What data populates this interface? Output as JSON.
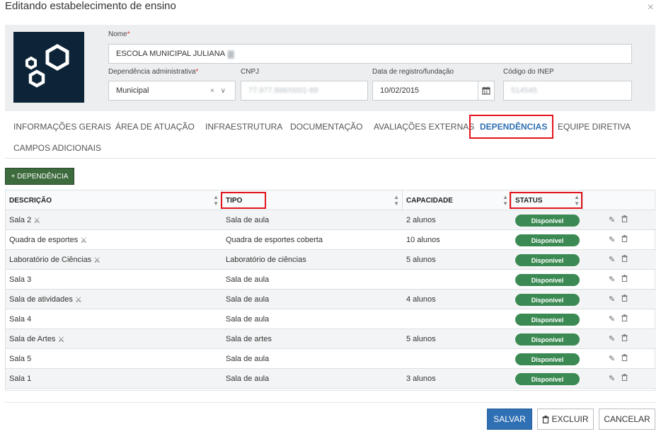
{
  "modal": {
    "title": "Editando estabelecimento de ensino",
    "close_label": "×"
  },
  "form": {
    "nome_label": "Nome",
    "nome_value": "ESCOLA MUNICIPAL JULIANA",
    "dep_admin_label": "Dependência administrativa",
    "dep_admin_value": "Municipal",
    "cnpj_label": "CNPJ",
    "cnpj_value": "77.977.866/0001-89",
    "data_label": "Data de registro/fundação",
    "data_value": "10/02/2015",
    "inep_label": "Código do INEP",
    "inep_value": "514545",
    "required_mark": "*",
    "clear_caret": "× ∨"
  },
  "tabs": [
    {
      "label": "INFORMAÇÕES GERAIS"
    },
    {
      "label": "ÁREA DE ATUAÇÃO"
    },
    {
      "label": "INFRAESTRUTURA"
    },
    {
      "label": "DOCUMENTAÇÃO"
    },
    {
      "label": "AVALIAÇÕES EXTERNAS"
    },
    {
      "label": "DEPENDÊNCIAS"
    },
    {
      "label": "EQUIPE DIRETIVA"
    },
    {
      "label": "CAMPOS ADICIONAIS"
    }
  ],
  "add_button_label": "+ DEPENDÊNCIA",
  "table": {
    "headers": [
      "DESCRIÇÃO",
      "TIPO",
      "CAPACIDADE",
      "STATUS"
    ],
    "rows": [
      {
        "descricao": "Sala 2",
        "icon": true,
        "tipo": "Sala de aula",
        "capacidade": "2 alunos",
        "status": "Disponível"
      },
      {
        "descricao": "Quadra de esportes",
        "icon": true,
        "tipo": "Quadra de esportes coberta",
        "capacidade": "10 alunos",
        "status": "Disponível"
      },
      {
        "descricao": "Laboratório de Ciências",
        "icon": true,
        "tipo": "Laboratório de ciências",
        "capacidade": "5 alunos",
        "status": "Disponível"
      },
      {
        "descricao": "Sala 3",
        "icon": false,
        "tipo": "Sala de aula",
        "capacidade": "",
        "status": "Disponível"
      },
      {
        "descricao": "Sala de atividades",
        "icon": true,
        "tipo": "Sala de aula",
        "capacidade": "4 alunos",
        "status": "Disponível"
      },
      {
        "descricao": "Sala 4",
        "icon": false,
        "tipo": "Sala de aula",
        "capacidade": "",
        "status": "Disponível"
      },
      {
        "descricao": "Sala de Artes",
        "icon": true,
        "tipo": "Sala de artes",
        "capacidade": "5 alunos",
        "status": "Disponível"
      },
      {
        "descricao": "Sala 5",
        "icon": false,
        "tipo": "Sala de aula",
        "capacidade": "",
        "status": "Disponível"
      },
      {
        "descricao": "Sala 1",
        "icon": false,
        "tipo": "Sala de aula",
        "capacidade": "3 alunos",
        "status": "Disponível"
      }
    ]
  },
  "footer": {
    "save_label": "SALVAR",
    "delete_label": "EXCLUIR",
    "cancel_label": "CANCELAR"
  },
  "colors": {
    "primary": "#2f6fb3",
    "status_green": "#3c8a53",
    "add_button": "#3d6b3d",
    "highlight_red": "#e2141d",
    "logo_bg": "#0d2438"
  }
}
